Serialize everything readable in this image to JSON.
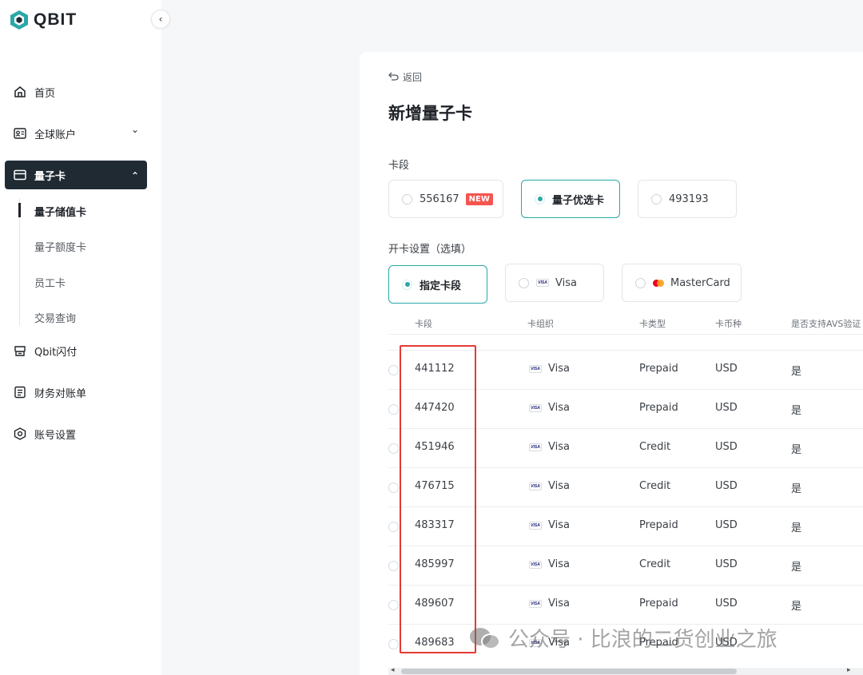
{
  "app": {
    "logo_text": "QBIT",
    "collapse_glyph": "‹"
  },
  "sidebar": {
    "items": [
      {
        "label": "首页",
        "icon": "home-icon"
      },
      {
        "label": "全球账户",
        "icon": "account-card-icon",
        "chevron": "⌄"
      },
      {
        "label": "量子卡",
        "icon": "card-icon",
        "chevron": "⌃",
        "active": true
      },
      {
        "label": "Qbit闪付",
        "icon": "quickpay-icon"
      },
      {
        "label": "财务对账单",
        "icon": "statement-icon"
      },
      {
        "label": "账号设置",
        "icon": "settings-icon"
      }
    ],
    "sub_items": [
      {
        "label": "量子储值卡",
        "active": true
      },
      {
        "label": "量子额度卡"
      },
      {
        "label": "员工卡"
      },
      {
        "label": "交易查询"
      }
    ]
  },
  "page": {
    "back_label": "返回",
    "title": "新增量子卡",
    "section_segment": "卡段",
    "section_settings": "开卡设置（选填）"
  },
  "segment_options": [
    {
      "label": "556167",
      "badge": "NEW",
      "selected": false
    },
    {
      "label": "量子优选卡",
      "selected": true
    },
    {
      "label": "493193",
      "selected": false
    }
  ],
  "setting_options": [
    {
      "label": "指定卡段",
      "selected": true
    },
    {
      "label": "Visa",
      "selected": false
    },
    {
      "label": "MasterCard",
      "selected": false
    }
  ],
  "brand_mark": "VISA",
  "table": {
    "headers": [
      "卡段",
      "卡组织",
      "卡类型",
      "卡币种",
      "是否支持AVS验证"
    ],
    "rows": [
      {
        "segment": "441112",
        "network": "Visa",
        "type": "Prepaid",
        "currency": "USD",
        "avs": "是"
      },
      {
        "segment": "447420",
        "network": "Visa",
        "type": "Prepaid",
        "currency": "USD",
        "avs": "是"
      },
      {
        "segment": "451946",
        "network": "Visa",
        "type": "Credit",
        "currency": "USD",
        "avs": "是"
      },
      {
        "segment": "476715",
        "network": "Visa",
        "type": "Credit",
        "currency": "USD",
        "avs": "是"
      },
      {
        "segment": "483317",
        "network": "Visa",
        "type": "Prepaid",
        "currency": "USD",
        "avs": "是"
      },
      {
        "segment": "485997",
        "network": "Visa",
        "type": "Credit",
        "currency": "USD",
        "avs": "是"
      },
      {
        "segment": "489607",
        "network": "Visa",
        "type": "Prepaid",
        "currency": "USD",
        "avs": "是"
      },
      {
        "segment": "489683",
        "network": "Visa",
        "type": "Prepaid",
        "currency": "USD",
        "avs": ""
      }
    ]
  },
  "watermark": {
    "text": "公众号 · 比浪的二货创业之旅"
  },
  "colors": {
    "accent": "#2aa8a8",
    "nav_active_bg": "#1f2a33",
    "highlight_box": "#e53935",
    "new_badge": "#f5544f"
  }
}
